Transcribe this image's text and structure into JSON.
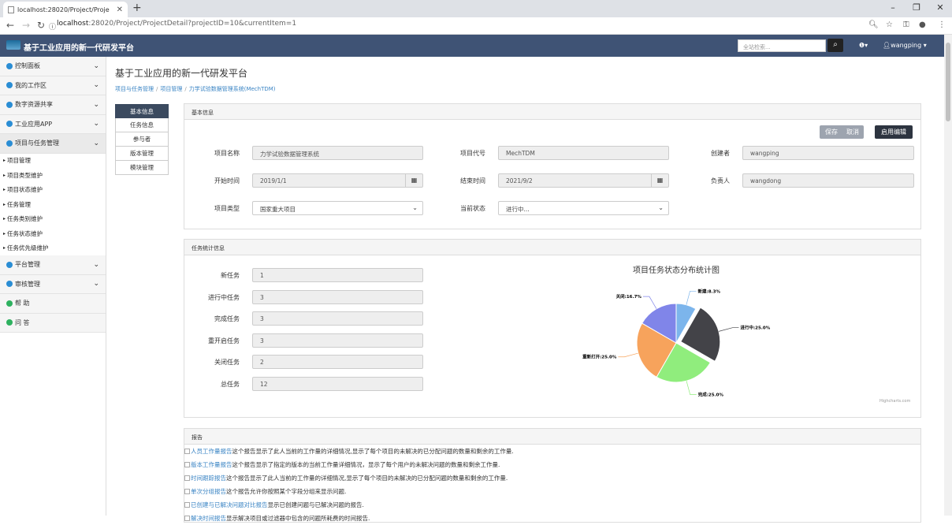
{
  "browser": {
    "tab_title": "localhost:28020/Project/Proje",
    "url_host": "localhost",
    "url_path": ":28020/Project/ProjectDetail?projectID=10&currentItem=1"
  },
  "header": {
    "title": "基于工业应用的新一代研发平台",
    "search_placeholder": "全站检索...",
    "user": "wangping"
  },
  "sidebar": {
    "groups": [
      {
        "label": "控制面板"
      },
      {
        "label": "我的工作区"
      },
      {
        "label": "数字资源共享"
      },
      {
        "label": "工业应用APP"
      },
      {
        "label": "项目与任务管理"
      }
    ],
    "sub_items": [
      "项目管理",
      "项目类型维护",
      "项目状态维护",
      "任务管理",
      "任务类别维护",
      "任务状态维护",
      "任务优先级维护"
    ],
    "groups2": [
      {
        "label": "平台管理"
      },
      {
        "label": "审核管理"
      },
      {
        "label": "帮 助"
      },
      {
        "label": "问 答"
      }
    ]
  },
  "main": {
    "title": "基于工业应用的新一代研发平台",
    "breadcrumb": [
      "项目与任务管理",
      "项目管理",
      "力学试验数据管理系统(MechTDM)"
    ],
    "tabs": [
      "基本信息",
      "任务信息",
      "参与者",
      "版本管理",
      "模块管理"
    ]
  },
  "basic": {
    "heading": "基本信息",
    "save": "保存",
    "cancel": "取消",
    "enable_edit": "启用编辑",
    "name_label": "项目名称",
    "name": "力学试验数据管理系统",
    "code_label": "项目代号",
    "code": "MechTDM",
    "creator_label": "创建者",
    "creator": "wangping",
    "start_label": "开始时间",
    "start": "2019/1/1",
    "end_label": "结束时间",
    "end": "2021/9/2",
    "owner_label": "负责人",
    "owner": "wangdong",
    "type_label": "项目类型",
    "type": "国家重大项目",
    "status_label": "当前状态",
    "status": "进行中..."
  },
  "stats": {
    "heading": "任务统计信息",
    "rows": [
      {
        "label": "新任务",
        "value": "1"
      },
      {
        "label": "进行中任务",
        "value": "3"
      },
      {
        "label": "完成任务",
        "value": "3"
      },
      {
        "label": "重开启任务",
        "value": "3"
      },
      {
        "label": "关闭任务",
        "value": "2"
      },
      {
        "label": "总任务",
        "value": "12"
      }
    ],
    "credit": "Highcharts.com"
  },
  "chart_data": {
    "type": "pie",
    "title": "项目任务状态分布统计图",
    "slices": [
      {
        "label": "新建",
        "value": 8.3,
        "text": "新建:8.3%",
        "color": "#7cb5ec"
      },
      {
        "label": "进行中",
        "value": 25.0,
        "text": "进行中:25.0%",
        "color": "#434348"
      },
      {
        "label": "完成",
        "value": 25.0,
        "text": "完成:25.0%",
        "color": "#90ed7d"
      },
      {
        "label": "重新打开",
        "value": 25.0,
        "text": "重新打开:25.0%",
        "color": "#f7a35c"
      },
      {
        "label": "关闭",
        "value": 16.7,
        "text": "关闭:16.7%",
        "color": "#8085e9"
      }
    ]
  },
  "report": {
    "heading": "报告",
    "items": [
      {
        "link": "人员工作量报告",
        "desc": "这个报告显示了此人当前的工作量的详细情况,显示了每个项目的未解决的已分配问题的数量和剩余的工作量."
      },
      {
        "link": "版本工作量报告",
        "desc": " 这个报告显示了指定的版本的当前工作量详细情况，显示了每个用户的未解决问题的数量和剩余工作量."
      },
      {
        "link": "时间跟踪报告",
        "desc": "这个报告显示了此人当前的工作量的详细情况,显示了每个项目的未解决的已分配问题的数量和剩余的工作量."
      },
      {
        "link": "单次分组报告",
        "desc": "这个报告允许你按照某个字段分组来显示问题."
      },
      {
        "link": "已创建与已解决问题对比报告",
        "desc": "显示已创建问题与已解决问题的报告."
      },
      {
        "link": "解决时间报告",
        "desc": "显示解决项目或过滤器中包含的问题所耗费的时间报告."
      }
    ]
  }
}
